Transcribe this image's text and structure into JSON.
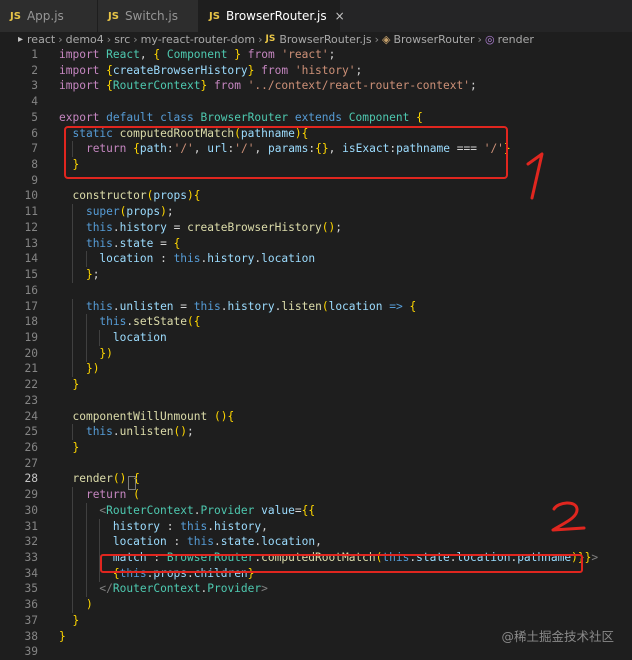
{
  "tabs": [
    {
      "icon": "JS",
      "label": "App.js"
    },
    {
      "icon": "JS",
      "label": "Switch.js"
    },
    {
      "icon": "JS",
      "label": "BrowserRouter.js",
      "close": "×"
    }
  ],
  "breadcrumb": {
    "segments": [
      "react",
      "demo4",
      "src",
      "my-react-router-dom"
    ],
    "file_icon": "JS",
    "file": "BrowserRouter.js",
    "class_name": "BrowserRouter",
    "method": "render"
  },
  "editor": {
    "active_line": 28,
    "line_numbers": [
      "1",
      "2",
      "3",
      "4",
      "5",
      "6",
      "7",
      "8",
      "9",
      "10",
      "11",
      "12",
      "13",
      "14",
      "15",
      "16",
      "17",
      "18",
      "19",
      "20",
      "21",
      "22",
      "23",
      "24",
      "25",
      "26",
      "27",
      "28",
      "29",
      "30",
      "31",
      "32",
      "33",
      "34",
      "35",
      "36",
      "37",
      "38",
      "39"
    ],
    "lines": [
      "import React, { Component } from 'react';",
      "import {createBrowserHistory} from 'history';",
      "import {RouterContext} from '../context/react-router-context';",
      "",
      "export default class BrowserRouter extends Component {",
      "  static computedRootMatch(pathname){",
      "    return {path:'/', url:'/', params:{}, isExact:pathname === '/'}",
      "  }",
      "",
      "  constructor(props){",
      "    super(props);",
      "    this.history = createBrowserHistory();",
      "    this.state = {",
      "      location : this.history.location",
      "    };",
      "",
      "    this.unlisten = this.history.listen(location => {",
      "      this.setState({",
      "        location",
      "      })",
      "    })",
      "  }",
      "",
      "  componentWillUnmount (){",
      "    this.unlisten();",
      "  }",
      "",
      "  render() {",
      "    return (",
      "      <RouterContext.Provider value={{",
      "        history : this.history,",
      "        location : this.state.location,",
      "        match : BrowserRouter.computedRootMatch(this.state.location.pathname)}}>",
      "        {this.props.children}",
      "      </RouterContext.Provider>",
      "    )",
      "  }",
      "}",
      ""
    ]
  },
  "annotations": {
    "mark_1": "1",
    "mark_2": "2"
  },
  "watermark": "@稀土掘金技术社区",
  "colors": {
    "background": "#1e1e1e",
    "annotation_red": "#e0261f",
    "js_icon": "#e8c547"
  }
}
